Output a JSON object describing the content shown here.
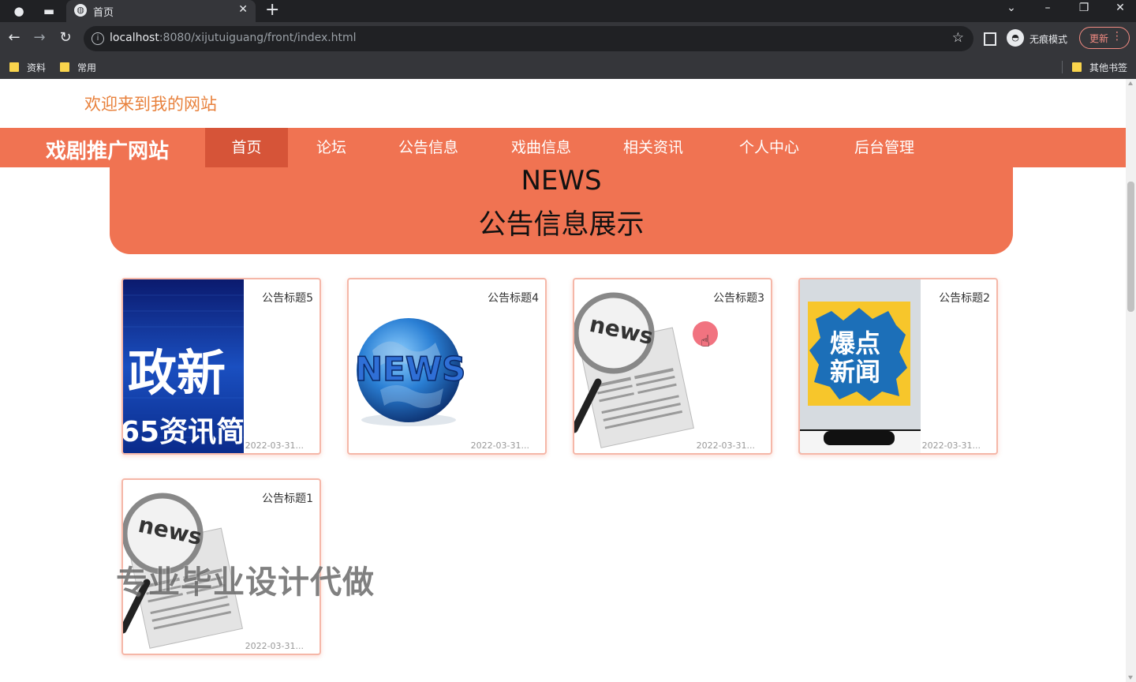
{
  "browser": {
    "tab_title": "首页",
    "url_host": "localhost",
    "url_rest": ":8080/xijutuiguang/front/index.html",
    "incognito_label": "无痕模式",
    "update_label": "更新",
    "bookmarks": [
      "资料",
      "常用"
    ],
    "other_bookmarks": "其他书签"
  },
  "header": {
    "welcome": "欢迎来到我的网站",
    "brand": "戏剧推广网站"
  },
  "nav": {
    "items": [
      "首页",
      "论坛",
      "公告信息",
      "戏曲信息",
      "相关资讯",
      "个人中心",
      "后台管理"
    ],
    "active": "首页"
  },
  "news": {
    "title_en": "NEWS",
    "title_cn": "公告信息展示"
  },
  "cards": [
    {
      "title": "公告标题5",
      "date": "2022-03-31...",
      "image": "政新 / 65资讯简 banner"
    },
    {
      "title": "公告标题4",
      "date": "2022-03-31...",
      "image": "news globe"
    },
    {
      "title": "公告标题3",
      "date": "2022-03-31...",
      "image": "news magnifier"
    },
    {
      "title": "公告标题2",
      "date": "2022-03-31...",
      "image": "爆点新闻 phone"
    },
    {
      "title": "公告标题1",
      "date": "2022-03-31...",
      "image": "news magnifier"
    }
  ],
  "thumb_text": {
    "c5_big": "政新",
    "c5_small": "65资讯简",
    "c4": "NEWS",
    "c3": "news",
    "c2": [
      "爆点",
      "新闻"
    ],
    "c1": "news"
  },
  "overlay": {
    "watermark": "专业毕业设计代做"
  },
  "colors": {
    "accent": "#f07352",
    "active_nav": "#d65438",
    "welcome_text": "#e8813c",
    "card_border": "#f5b7a8"
  }
}
